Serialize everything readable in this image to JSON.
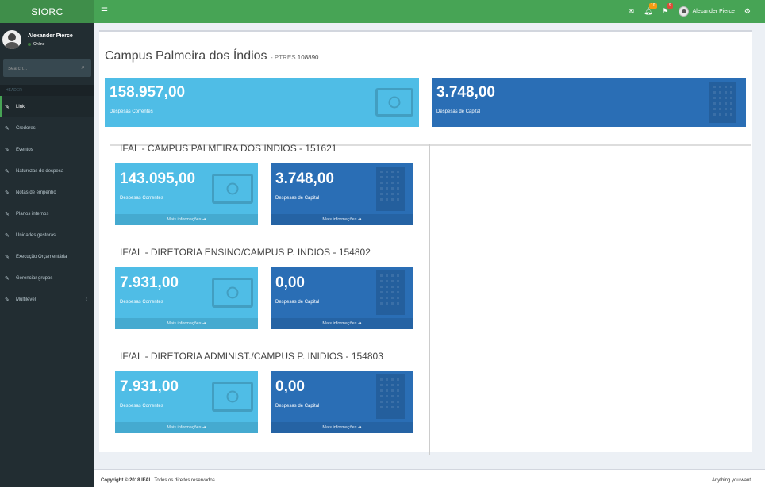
{
  "app": {
    "logo": "SIORC"
  },
  "header": {
    "menu_icon": "hamburger-icon",
    "icons": [
      {
        "name": "envelope-icon",
        "badge": "",
        "badge_color": "#00a65a"
      },
      {
        "name": "bell-icon",
        "badge": "10",
        "badge_color": "#f39c12"
      },
      {
        "name": "flag-icon",
        "badge": "9",
        "badge_color": "#dd4b39"
      }
    ],
    "user_name": "Alexander Pierce",
    "settings_icon": "gears-icon"
  },
  "sidebar": {
    "user_name": "Alexander Pierce",
    "status": "Online",
    "search_placeholder": "Search...",
    "header_label": "HEADER",
    "items": [
      {
        "label": "Link",
        "icon": "link-icon"
      },
      {
        "label": "Credores",
        "icon": "link-icon"
      },
      {
        "label": "Eventos",
        "icon": "link-icon"
      },
      {
        "label": "Naturezas de despesa",
        "icon": "link-icon"
      },
      {
        "label": "Notas de empenho",
        "icon": "link-icon"
      },
      {
        "label": "Planos internos",
        "icon": "link-icon"
      },
      {
        "label": "Unidades gestoras",
        "icon": "link-icon"
      },
      {
        "label": "Execução Orçamentária",
        "icon": "link-icon"
      },
      {
        "label": "Gerenciar grupos",
        "icon": "link-icon"
      },
      {
        "label": "Multilevel",
        "icon": "link-icon",
        "chevron": "‹"
      }
    ]
  },
  "main": {
    "title": "Campus Palmeira dos Índios",
    "subtitle_label": "PTRES",
    "subtitle_value": "108890",
    "summary": [
      {
        "value": "158.957,00",
        "label": "Despesas Correntes",
        "color": "#4fbde6"
      },
      {
        "value": "3.748,00",
        "label": "Despesas de Capital",
        "color": "#2a6eb5"
      }
    ],
    "sections": [
      {
        "title": "IFAL - CAMPUS PALMEIRA DOS INDIOS - 151621",
        "boxes": [
          {
            "value": "143.095,00",
            "label": "Despesas Correntes",
            "more": "Mais informações"
          },
          {
            "value": "3.748,00",
            "label": "Despesas de Capital",
            "more": "Mais informações"
          }
        ]
      },
      {
        "title": "IF/AL - DIRETORIA ENSINO/CAMPUS P. INDIOS - 154802",
        "boxes": [
          {
            "value": "7.931,00",
            "label": "Despesas Correntes",
            "more": "Mais informações"
          },
          {
            "value": "0,00",
            "label": "Despesas de Capital",
            "more": "Mais informações"
          }
        ]
      },
      {
        "title": "IF/AL - DIRETORIA ADMINIST./CAMPUS P. INIDIOS - 154803",
        "boxes": [
          {
            "value": "7.931,00",
            "label": "Despesas Correntes",
            "more": "Mais informações"
          },
          {
            "value": "0,00",
            "label": "Despesas de Capital",
            "more": "Mais informações"
          }
        ]
      }
    ]
  },
  "footer": {
    "copyright_label": "Copyright © 2018",
    "company": "IFAL.",
    "rights": "Todos os direitos reservados.",
    "right_text": "Anything you want"
  }
}
